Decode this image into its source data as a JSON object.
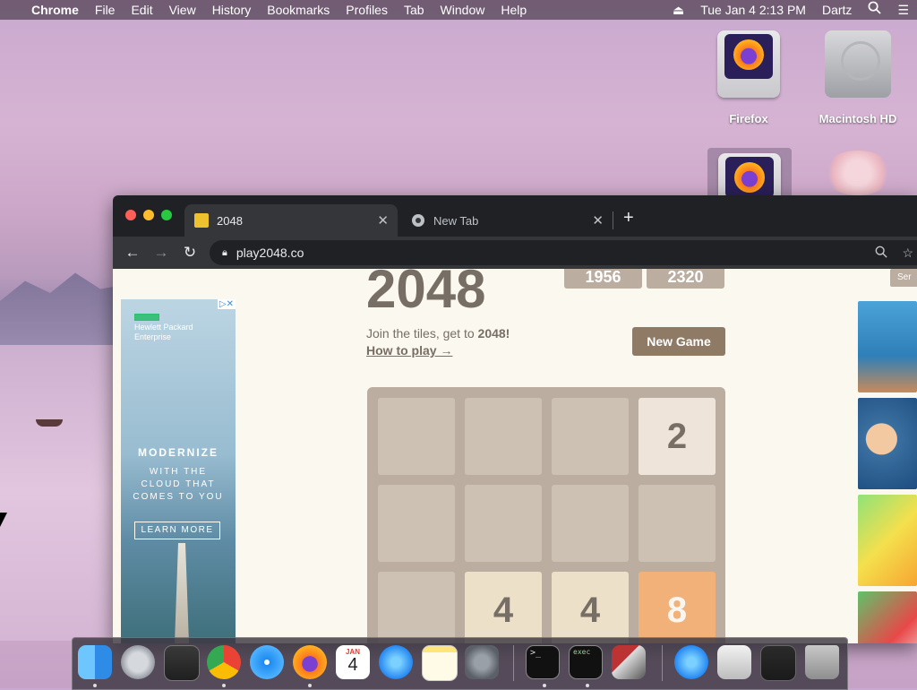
{
  "menubar": {
    "app_name": "Chrome",
    "menus": [
      "File",
      "Edit",
      "View",
      "History",
      "Bookmarks",
      "Profiles",
      "Tab",
      "Window",
      "Help"
    ],
    "clock": "Tue Jan 4  2:13 PM",
    "user": "Dartz"
  },
  "desktop": {
    "icons": [
      {
        "label": "Firefox"
      },
      {
        "label": "Macintosh HD"
      }
    ]
  },
  "browser": {
    "tabs": [
      {
        "title": "2048",
        "active": true
      },
      {
        "title": "New Tab",
        "active": false
      }
    ],
    "url": "play2048.co"
  },
  "game": {
    "title": "2048",
    "score": "1956",
    "best": "2320",
    "intro_text": "Join the tiles, get to ",
    "intro_goal": "2048!",
    "how_to_play": "How to play →",
    "new_game_label": "New Game",
    "grid": [
      [
        "",
        "",
        "",
        "2"
      ],
      [
        "",
        "",
        "",
        ""
      ],
      [
        "",
        "4",
        "4",
        "8"
      ]
    ],
    "side_button": "Ser"
  },
  "ad": {
    "brand_line1": "Hewlett Packard",
    "brand_line2": "Enterprise",
    "headline": "MODERNIZE",
    "tagline1": "WITH THE",
    "tagline2": "CLOUD THAT",
    "tagline3": "COMES TO YOU",
    "cta": "LEARN MORE",
    "badge": "▷✕"
  },
  "dock": {
    "calendar_month": "JAN",
    "calendar_day": "4",
    "terminal_text": ">_",
    "exec_text": "exec"
  },
  "colors": {
    "tile_2": "#eee4da",
    "tile_4": "#ede0c8",
    "tile_8": "#f2b179",
    "empty_cell": "#cdc1b4",
    "board": "#bbada0",
    "button": "#8f7a66"
  }
}
